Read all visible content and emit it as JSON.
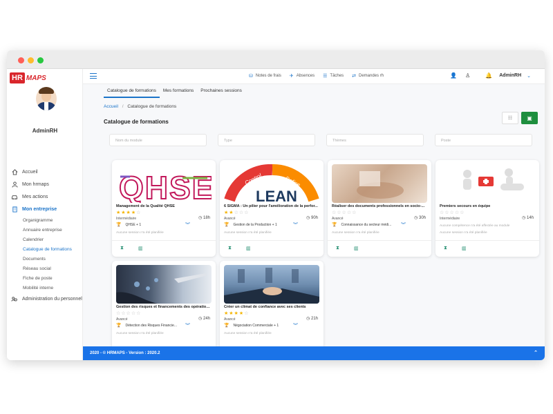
{
  "logo": {
    "hr": "HR",
    "maps": "MAPS"
  },
  "user": {
    "name": "AdminRH"
  },
  "nav": [
    {
      "label": "Accueil",
      "icon": "home-icon"
    },
    {
      "label": "Mon hrmaps",
      "icon": "user-icon"
    },
    {
      "label": "Mes actions",
      "icon": "car-icon"
    },
    {
      "label": "Mon entreprise",
      "icon": "building-icon",
      "active": true
    },
    {
      "label": "Administration du personnel",
      "icon": "users-cog-icon"
    }
  ],
  "subnav": [
    "Organigramme",
    "Annuaire entreprise",
    "Calendrier",
    "Catalogue de formations",
    "Documents",
    "Réseau social",
    "Fiche de poste",
    "Mobilité interne"
  ],
  "topbar": {
    "links": [
      "Notes de frais",
      "Absences",
      "Tâches",
      "Demandes rh"
    ],
    "admin": "AdminRH"
  },
  "tabs": [
    "Catalogue de formations",
    "Mes formations",
    "Prochaines sessions"
  ],
  "breadcrumb": {
    "home": "Accueil",
    "sep": "/",
    "current": "Catalogue de formations"
  },
  "page_title": "Catalogue de formations",
  "filters": [
    "Nom du module",
    "Type",
    "Thèmes",
    "Poste"
  ],
  "cards": [
    {
      "title": "Management de la Qualité QHSE",
      "stars": 4,
      "level": "Intermédiaire",
      "duration": "18h",
      "tag": "QHSE + 1",
      "note": "Aucune session n'a été planifiée"
    },
    {
      "title": "6 SIGMA : Un pilier pour l'amélioration de la perfor...",
      "stars": 2,
      "level": "Avancé",
      "duration": "90h",
      "tag": "Gestion de la Production + 1",
      "note": "Aucune session n'a été planifiée"
    },
    {
      "title": "Réaliser des documents professionnels en socio-...",
      "stars": 0,
      "level": "Avancé",
      "duration": "30h",
      "tag": "Connaissance du secteur médi...",
      "note": "Aucune session n'a été planifiée"
    },
    {
      "title": "Premiers secours en équipe",
      "stars": 0,
      "level": "Intermédiaire",
      "duration": "14h",
      "tag": "",
      "note": "Aucune compétence n'a été affectée au module",
      "note2": "Aucune session n'a été planifiée"
    },
    {
      "title": "Gestion des risques et financements des opération...",
      "stars": 0,
      "level": "Avancé",
      "duration": "24h",
      "tag": "Détection des Risques Financie...",
      "note": "Aucune session n'a été planifiée"
    },
    {
      "title": "Créer un climat de confiance avec ses clients",
      "stars": 4,
      "level": "Avancé",
      "duration": "21h",
      "tag": "Négociation Commerciale + 1",
      "note": "Aucune session n'a été planifiée"
    }
  ],
  "footer": {
    "text": "2020 - © HRMAPS - Version : 2020.2"
  },
  "colors": {
    "accent": "#1a73c9",
    "footer": "#1a73e8",
    "brand": "#d9262c",
    "star": "#f4b400"
  }
}
